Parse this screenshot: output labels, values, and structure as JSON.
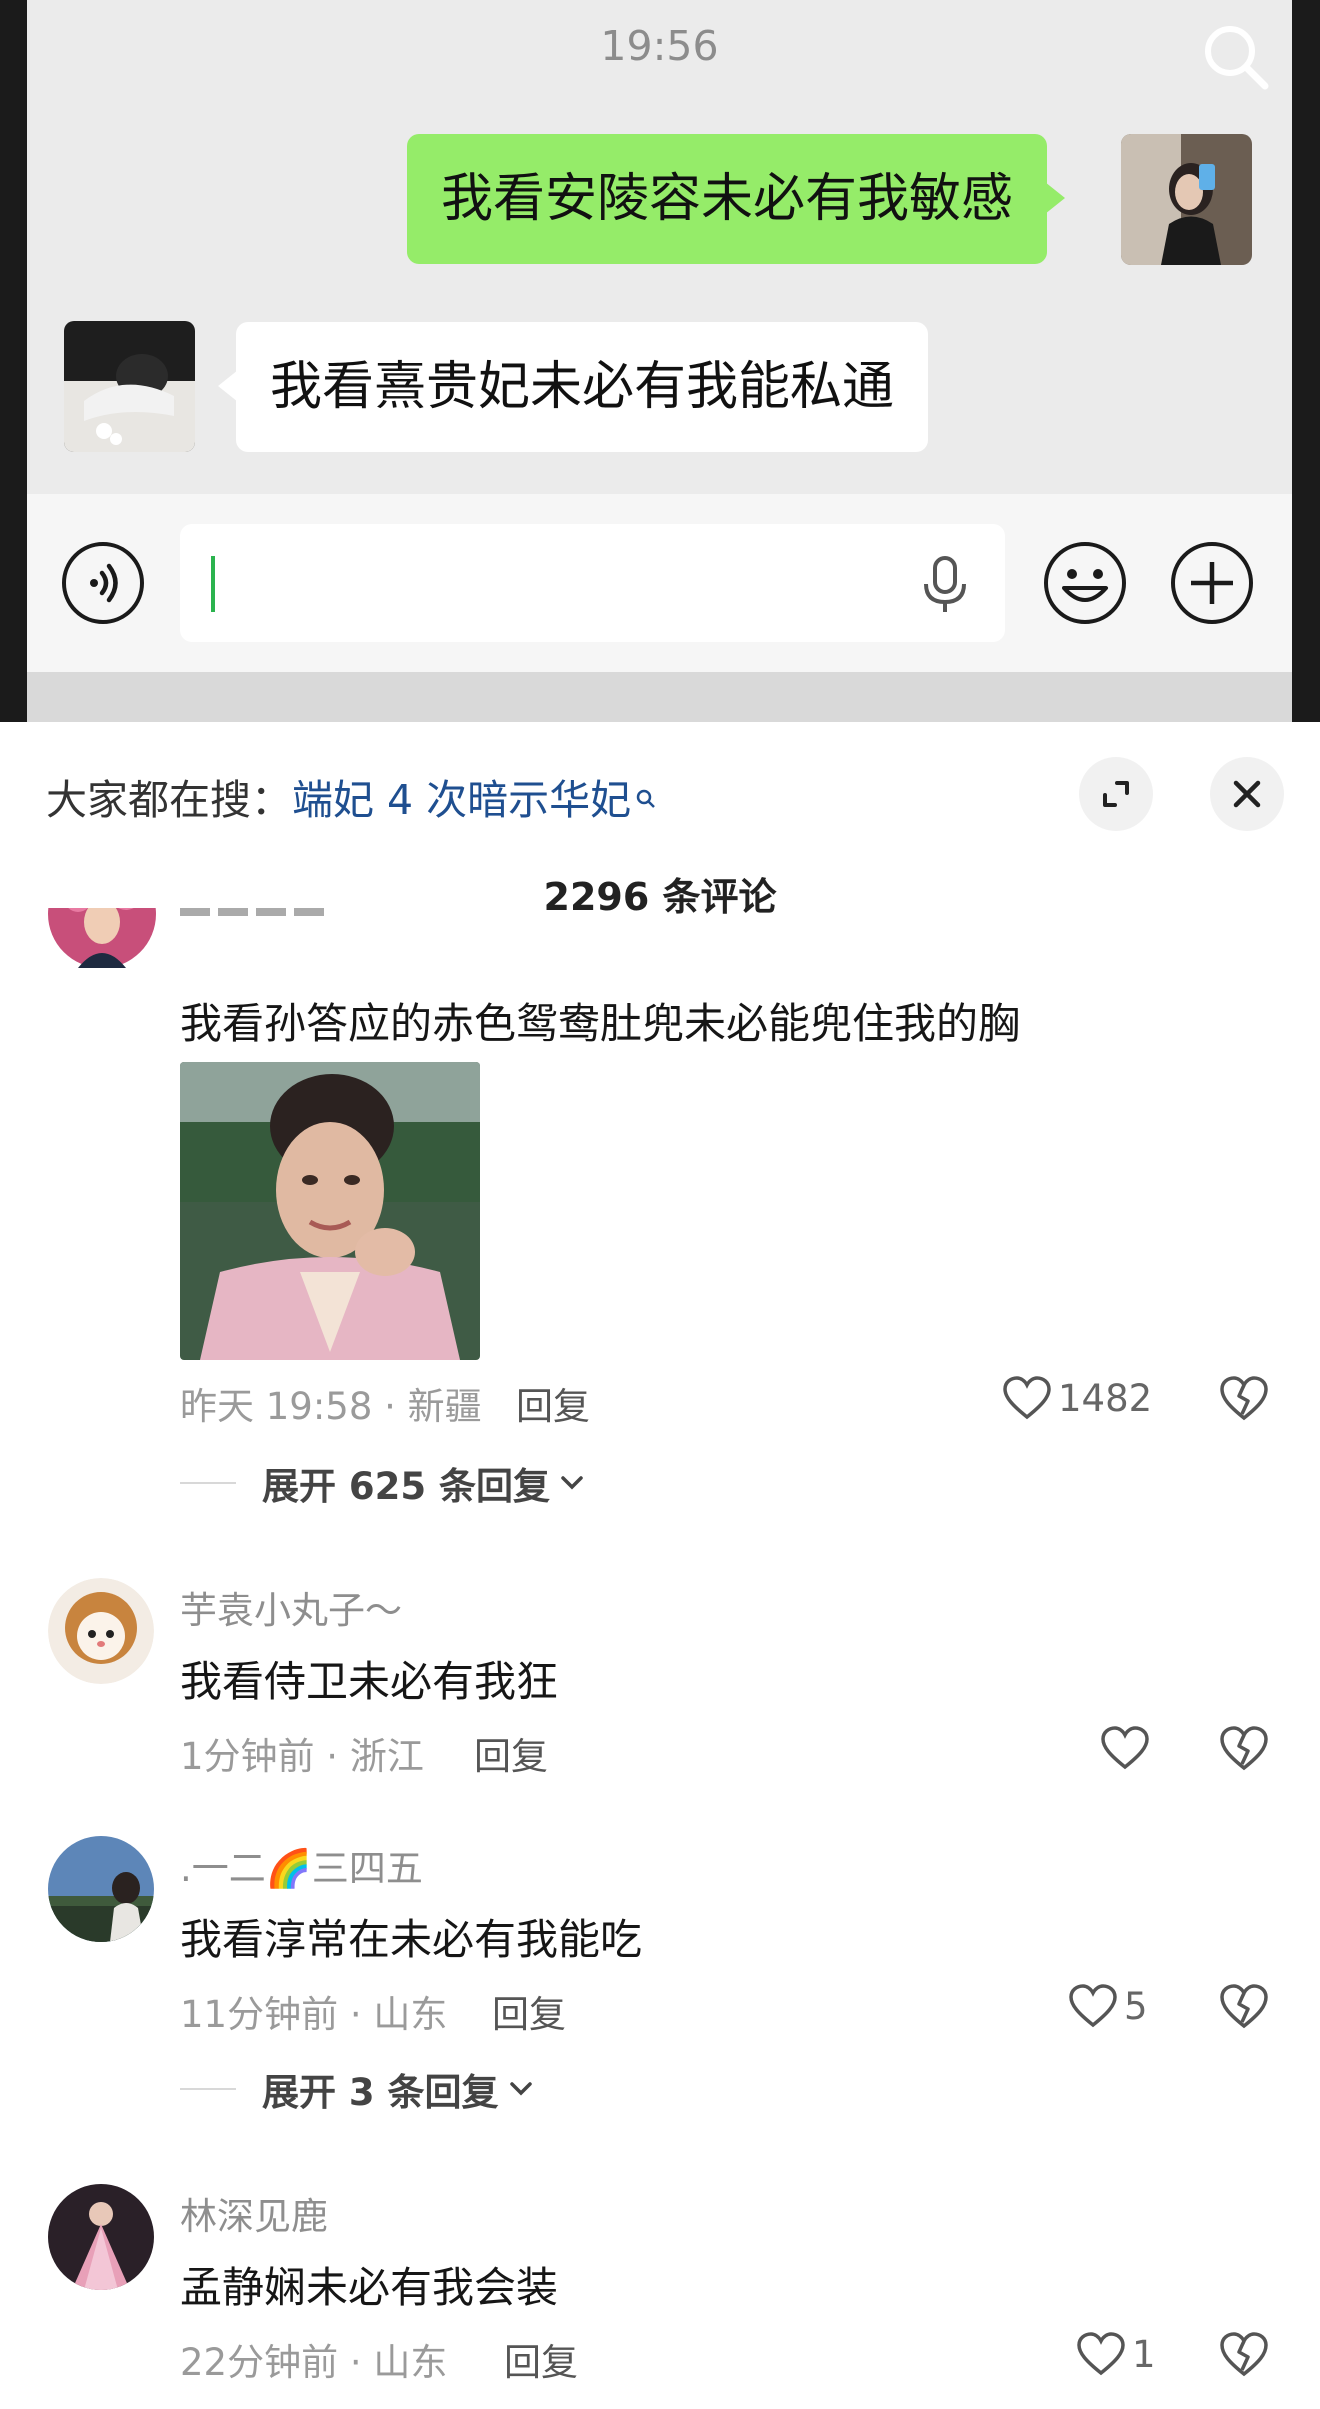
{
  "chat": {
    "time": "19:56",
    "messages": [
      {
        "side": "right",
        "text": "我看安陵容未必有我敏感"
      },
      {
        "side": "left",
        "text": "我看熹贵妃未必有我能私通"
      }
    ]
  },
  "sheet": {
    "search_hint_prefix": "大家都在搜：",
    "search_hint_link": "端妃 4 次暗示华妃",
    "comment_count": "2296 条评论"
  },
  "comments": [
    {
      "text": "我看孙答应的赤色鸳鸯肚兜未必能兜住我的胸",
      "meta": "昨天 19:58 · 新疆",
      "reply": "回复",
      "likes": "1482",
      "expand": "展开 625 条回复"
    },
    {
      "user": "芋袁小丸子～",
      "text": "我看侍卫未必有我狂",
      "meta": "1分钟前 · 浙江",
      "reply": "回复",
      "likes": ""
    },
    {
      "user": ".一二🌈三四五",
      "text": "我看淳常在未必有我能吃",
      "meta": "11分钟前 · 山东",
      "reply": "回复",
      "likes": "5",
      "expand": "展开 3 条回复"
    },
    {
      "user": "林深见鹿",
      "text": "孟静娴未必有我会装",
      "meta": "22分钟前 · 山东",
      "reply": "回复",
      "likes": "1"
    }
  ],
  "icons": {
    "search": "search-icon",
    "voice": "voice-icon",
    "mic": "microphone-icon",
    "emoji": "emoji-icon",
    "plus": "plus-icon",
    "expand": "expand-icon",
    "close": "close-icon",
    "like": "heart-icon",
    "dislike": "broken-heart-icon"
  },
  "colors": {
    "bubble_right": "#95ec69",
    "link": "#1f4f90",
    "chat_bg": "#ebebeb"
  }
}
